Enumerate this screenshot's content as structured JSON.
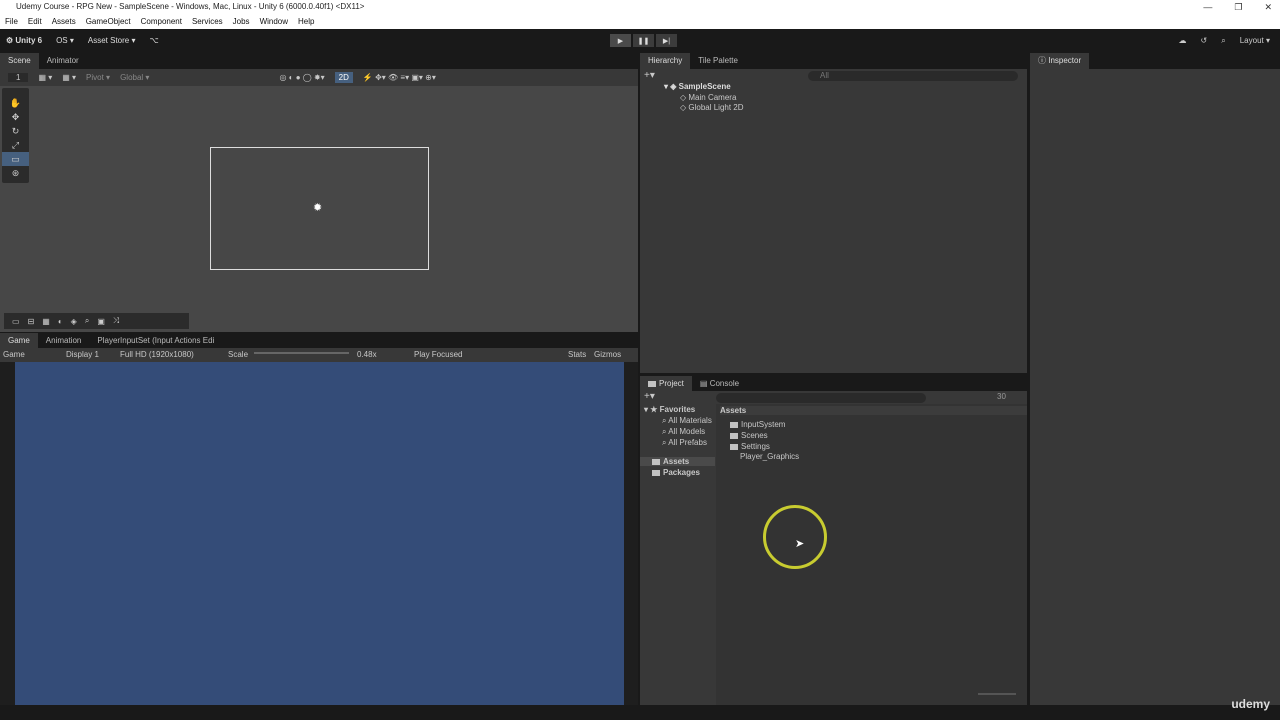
{
  "window": {
    "title": "Udemy Course - RPG New - SampleScene - Windows, Mac, Linux - Unity 6 (6000.0.40f1) <DX11>",
    "controls": [
      "—",
      "❐",
      "✕"
    ]
  },
  "menu": [
    "File",
    "Edit",
    "Assets",
    "GameObject",
    "Component",
    "Services",
    "Jobs",
    "Window",
    "Help"
  ],
  "toolbar": {
    "account": "Unity 6",
    "os": "OS ▾",
    "asset_store": "Asset Store ▾",
    "layout": "Layout ▾",
    "play": "▶",
    "pause": "❚❚",
    "step": "▶|"
  },
  "scene": {
    "tabs": [
      "Scene",
      "Animator"
    ],
    "pivot": "Pivot ▾",
    "global": "Global ▾",
    "mode_2d": "2D",
    "layer_num": "1"
  },
  "game": {
    "tabs": [
      "Game",
      "Animation",
      "PlayerInputSet (Input Actions Edi"
    ],
    "view": "Game",
    "display": "Display 1",
    "resolution": "Full HD (1920x1080)",
    "scale_label": "Scale",
    "scale_value": "0.48x",
    "play_mode": "Play Focused",
    "stats": "Stats",
    "gizmos": "Gizmos"
  },
  "hierarchy": {
    "tabs": [
      "Hierarchy",
      "Tile Palette"
    ],
    "search_placeholder": "All",
    "scene": "SampleScene",
    "items": [
      "Main Camera",
      "Global Light 2D"
    ]
  },
  "inspector": {
    "tab": "Inspector"
  },
  "project": {
    "tabs": [
      "Project",
      "Console"
    ],
    "favorites": "Favorites",
    "fav_items": [
      "All Materials",
      "All Models",
      "All Prefabs"
    ],
    "roots": [
      "Assets",
      "Packages"
    ],
    "breadcrumb": "Assets",
    "assets": [
      "InputSystem",
      "Scenes",
      "Settings",
      "Player_Graphics"
    ],
    "hidden_count": "30"
  },
  "watermark": "udemy"
}
